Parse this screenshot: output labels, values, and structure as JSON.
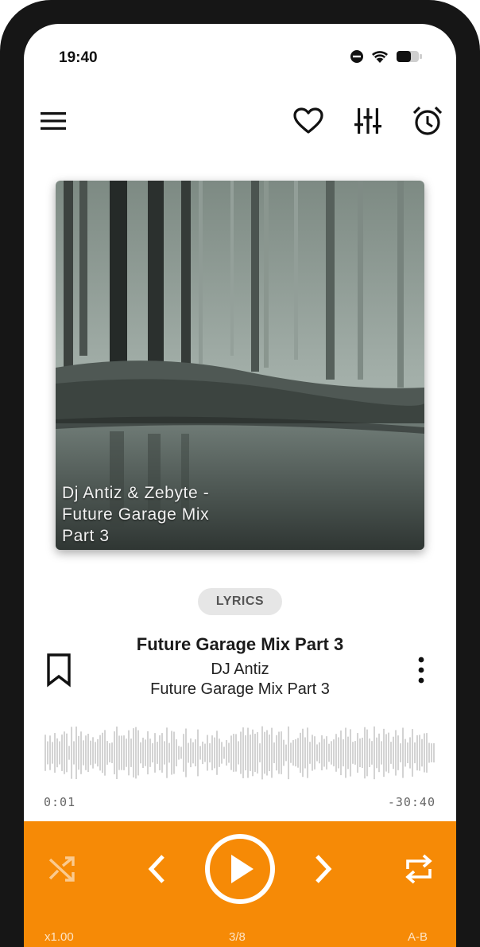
{
  "status_bar": {
    "time": "19:40"
  },
  "album_art": {
    "caption_line1": "Dj Antiz & Zebyte -",
    "caption_line2": "Future Garage Mix",
    "caption_line3": "Part 3"
  },
  "lyrics_button": "LYRICS",
  "track": {
    "title": "Future Garage Mix Part 3",
    "artist": "DJ Antiz",
    "album": "Future Garage Mix Part 3"
  },
  "progress": {
    "elapsed": "0:01",
    "remaining": "-30:40"
  },
  "controls": {
    "speed": "x1.00",
    "position": "3/8",
    "ab_repeat": "A-B",
    "accent_color": "#f68a06"
  },
  "icons": [
    "menu-icon",
    "heart-icon",
    "equalizer-icon",
    "alarm-icon",
    "bookmark-icon",
    "more-vert-icon",
    "shuffle-icon",
    "previous-icon",
    "play-icon",
    "next-icon",
    "repeat-icon"
  ]
}
